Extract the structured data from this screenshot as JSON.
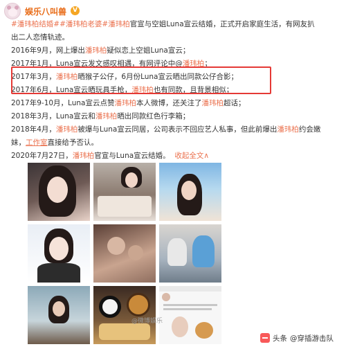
{
  "account": {
    "name": "娱乐八叫兽",
    "verified_badge": "V"
  },
  "post": {
    "tags_line": [
      "#潘玮柏结婚#",
      "#潘玮柏老婆#"
    ],
    "line1_hl": "潘玮柏",
    "line1_text": "官宣与空姐Luna宣云结婚，正式开启家庭生活，有网友扒",
    "line2": "出二人恋情轨迹。",
    "t1_pre": "2016年9月，网上爆出",
    "t1_hl": "潘玮柏",
    "t1_post": "疑似恋上空姐Luna宣云；",
    "t2_pre": "2017年1月，Luna宣云发文感叹相遇，有网评论中@",
    "t2_link": "潘玮柏",
    "t2_post": "；",
    "t3_pre": "2017年3月，",
    "t3_hl": "潘玮柏",
    "t3_post": "晒猴子公仔，6月份Luna宣云晒出同款公仔合影；",
    "t4_pre": "2017年6月，Luna宣云晒玩具手枪，",
    "t4_hl": "潘玮柏",
    "t4_post": "也有同款，且背景相似；",
    "t5_pre": "2017年9-10月，Luna宣云点赞",
    "t5_hl": "潘玮柏",
    "t5_post": "本人微博，还关注了",
    "t5_hl2": "潘玮柏",
    "t5_post2": "超话；",
    "t6_pre": "2018年3月，Luna宣云和",
    "t6_hl": "潘玮柏",
    "t6_post": "晒出同款红色行李箱；",
    "t7_pre": "2018年4月，",
    "t7_hl": "潘玮柏",
    "t7_post": "被爆与Luna宣云同居，公司表示不回应艺人私事，但此前爆出",
    "t7_hl2": "潘玮柏",
    "t7_post2": "约会嫩",
    "t8_pre": "妹，",
    "t8_link": "工作室",
    "t8_post": "直接给予否认。",
    "t9_pre": "2020年7月27日，",
    "t9_hl": "潘玮柏",
    "t9_post": "官宣与Luna宣云结婚。",
    "collapse_label": "收起全文",
    "collapse_arrow": "∧"
  },
  "images": {
    "items": [
      "photo-1",
      "photo-2",
      "photo-3",
      "photo-4",
      "photo-5",
      "photo-6",
      "photo-7",
      "photo-8",
      "photo-9"
    ],
    "watermark": "@微博娱乐"
  },
  "footer": {
    "platform": "头条",
    "handle": "@穿插游击队"
  },
  "colors": {
    "accent": "#eb7350",
    "highlight_box": "#e53935",
    "username": "#e86c18"
  }
}
